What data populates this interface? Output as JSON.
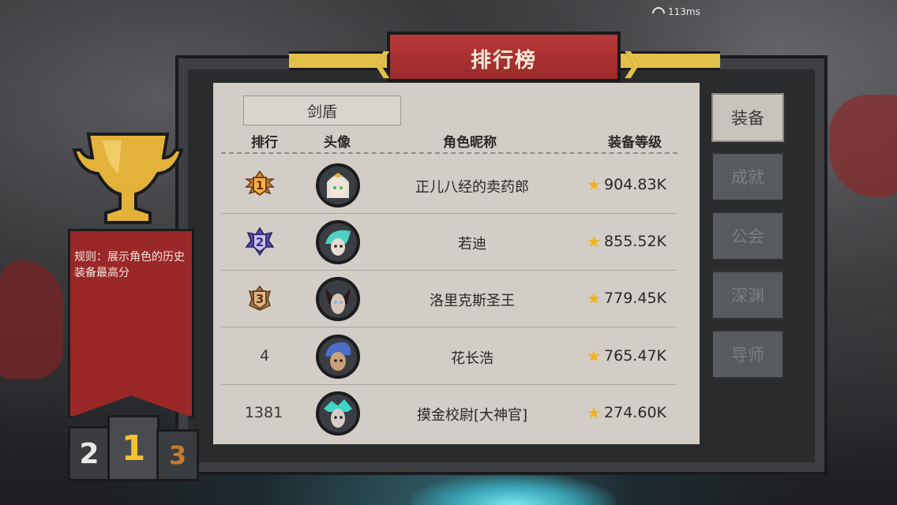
{
  "status": {
    "ping": "113ms"
  },
  "header": {
    "title": "排行榜"
  },
  "tabs": {
    "selected": "剑盾"
  },
  "table": {
    "columns": [
      "排行",
      "头像",
      "角色昵称",
      "装备等级"
    ],
    "rows": [
      {
        "rank": "1",
        "name": "正儿八经的卖药郎",
        "level": "904.83K",
        "badge": "gold"
      },
      {
        "rank": "2",
        "name": "若迪",
        "level": "855.52K",
        "badge": "purple"
      },
      {
        "rank": "3",
        "name": "洛里克斯圣王",
        "level": "779.45K",
        "badge": "bronze"
      },
      {
        "rank": "4",
        "name": "花长浩",
        "level": "765.47K",
        "badge": "none"
      },
      {
        "rank": "1381",
        "name": "摸金校尉[大神官]",
        "level": "274.60K",
        "badge": "none"
      }
    ]
  },
  "categories": [
    {
      "label": "装备",
      "active": true
    },
    {
      "label": "成就",
      "active": false
    },
    {
      "label": "公会",
      "active": false
    },
    {
      "label": "深渊",
      "active": false
    },
    {
      "label": "导师",
      "active": false
    }
  ],
  "rule": {
    "text": "规则：展示角色的历史装备最高分"
  },
  "podium": {
    "second": "2",
    "first": "1",
    "third": "3"
  },
  "colors": {
    "banner": "#9b2a2a",
    "gold": "#e3c04a",
    "panel": "#d2cdc6",
    "star": "#f0b21c"
  }
}
